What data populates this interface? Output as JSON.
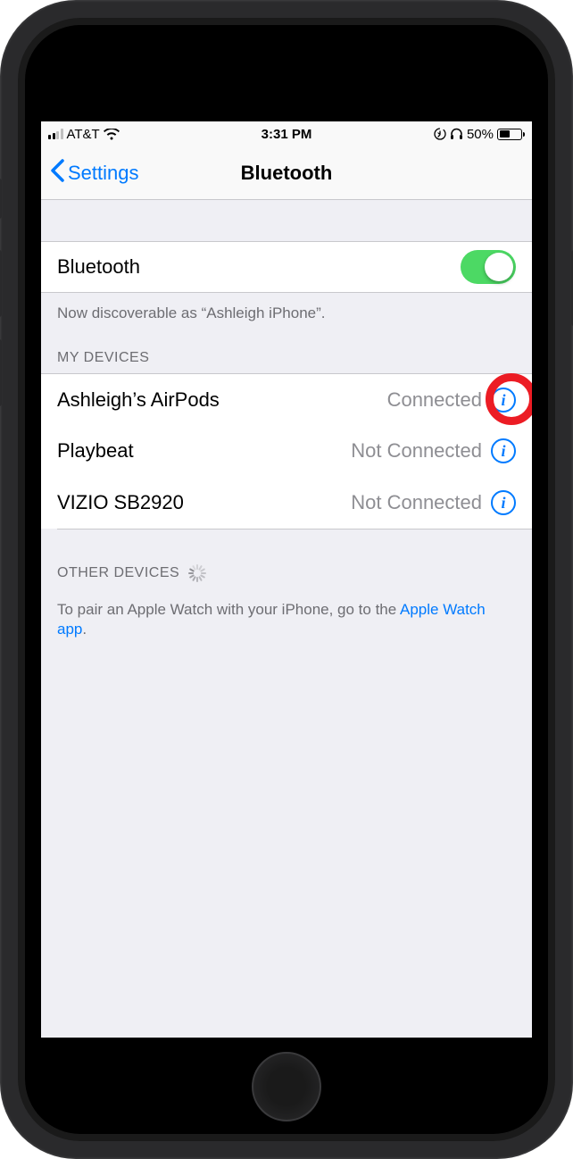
{
  "status_bar": {
    "carrier": "AT&T",
    "time": "3:31 PM",
    "battery_percent": "50%",
    "signal_bars": 2,
    "wifi": true,
    "rotation_lock": true,
    "headphones": true
  },
  "nav": {
    "back_label": "Settings",
    "title": "Bluetooth"
  },
  "bluetooth_toggle": {
    "label": "Bluetooth",
    "enabled": true
  },
  "discoverable_text": "Now discoverable as “Ashleigh iPhone”.",
  "my_devices": {
    "header": "MY DEVICES",
    "items": [
      {
        "name": "Ashleigh’s AirPods",
        "status": "Connected"
      },
      {
        "name": "Playbeat",
        "status": "Not Connected"
      },
      {
        "name": "VIZIO SB2920",
        "status": "Not Connected"
      }
    ]
  },
  "other_devices": {
    "header": "OTHER DEVICES",
    "footer_prefix": "To pair an Apple Watch with your iPhone, go to the ",
    "footer_link": "Apple Watch app",
    "footer_suffix": "."
  }
}
